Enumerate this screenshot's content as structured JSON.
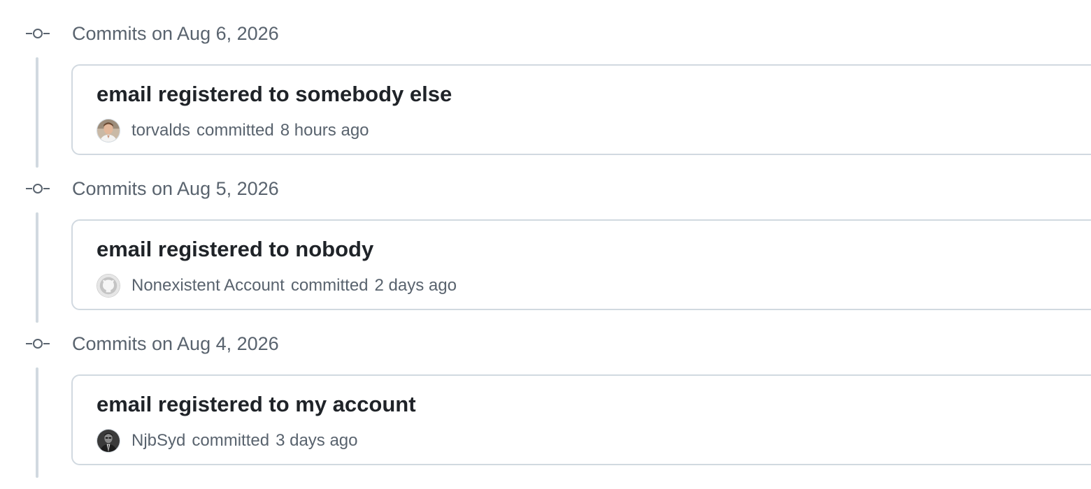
{
  "groups": [
    {
      "date_label": "Commits on Aug 6, 2026",
      "commit": {
        "title": "email registered to somebody else",
        "author": "torvalds",
        "verb": "committed",
        "time": "8 hours ago",
        "avatar": "user-photo-avatar"
      }
    },
    {
      "date_label": "Commits on Aug 5, 2026",
      "commit": {
        "title": "email registered to nobody",
        "author": "Nonexistent Account",
        "verb": "committed",
        "time": "2 days ago",
        "avatar": "github-octocat-avatar"
      }
    },
    {
      "date_label": "Commits on Aug 4, 2026",
      "commit": {
        "title": "email registered to my account",
        "author": "NjbSyd",
        "verb": "committed",
        "time": "3 days ago",
        "avatar": "user-photo-avatar"
      }
    }
  ],
  "colors": {
    "muted_text": "#59636e",
    "title_text": "#1f2328",
    "border": "#d1d9e0",
    "background": "#ffffff"
  }
}
